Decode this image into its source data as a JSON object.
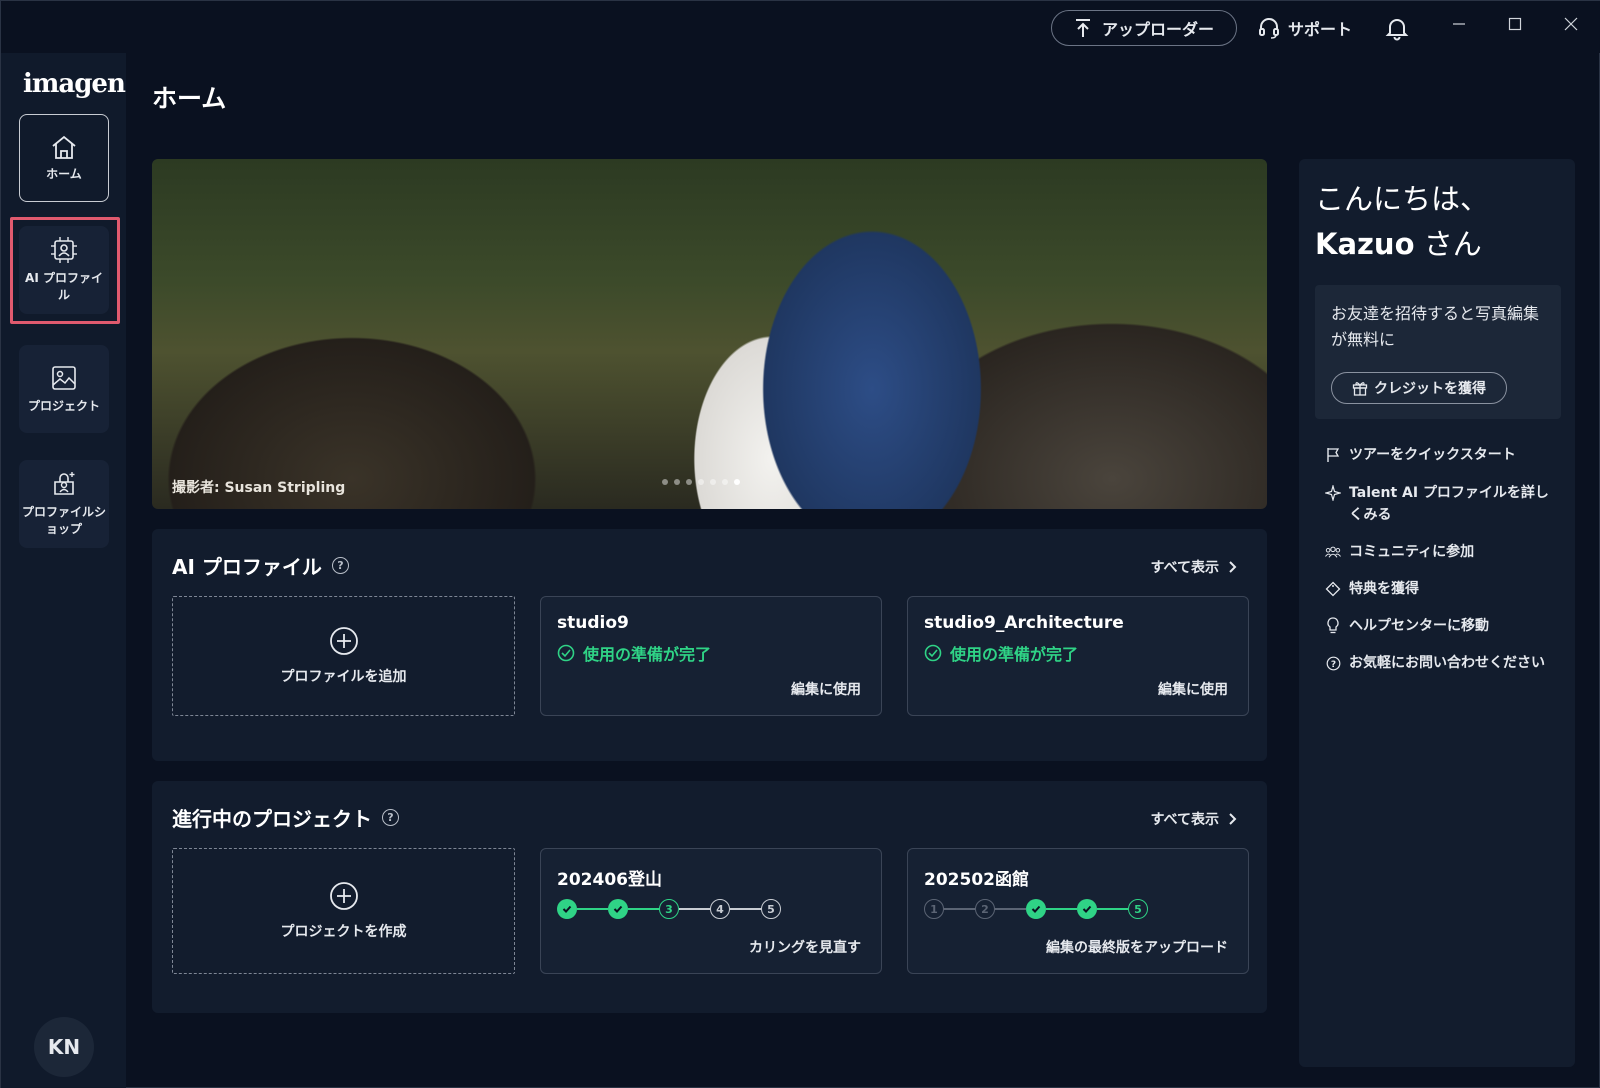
{
  "titlebar": {
    "uploader_label": "アップローダー",
    "support_label": "サポート"
  },
  "sidebar": {
    "logo": "imagen",
    "items": [
      {
        "label": "ホーム",
        "icon": "home-icon",
        "active": true
      },
      {
        "label": "AI プロファイル",
        "icon": "ai-profile-icon",
        "active": false
      },
      {
        "label": "プロジェクト",
        "icon": "project-icon",
        "active": false
      },
      {
        "label": "プロファイルショップ",
        "icon": "profile-shop-icon",
        "active": false
      }
    ],
    "avatar_initials": "KN"
  },
  "main": {
    "page_title": "ホーム",
    "hero": {
      "credit": "撮影者: Susan Stripling",
      "dots": 7,
      "active_dot": 6
    },
    "ai_profiles": {
      "title": "AI プロファイル",
      "see_all": "すべて表示",
      "add_label": "プロファイルを追加",
      "cards": [
        {
          "name": "studio9",
          "status": "使用の準備が完了",
          "action": "編集に使用"
        },
        {
          "name": "studio9_Architecture",
          "status": "使用の準備が完了",
          "action": "編集に使用"
        }
      ]
    },
    "projects": {
      "title": "進行中のプロジェクト",
      "see_all": "すべて表示",
      "create_label": "プロジェクトを作成",
      "cards": [
        {
          "name": "202406登山",
          "action": "カリングを見直す",
          "steps": [
            "done",
            "done",
            "cur",
            "todo",
            "todo"
          ],
          "labels": [
            "1",
            "2",
            "3",
            "4",
            "5"
          ]
        },
        {
          "name": "202502函館",
          "action": "編集の最終版をアップロード",
          "steps": [
            "dim",
            "dim",
            "done",
            "done",
            "cur"
          ],
          "labels": [
            "1",
            "2",
            "3",
            "4",
            "5"
          ]
        }
      ]
    }
  },
  "right_panel": {
    "greeting_line1": "こんにちは、",
    "user_name": "Kazuo",
    "greeting_suffix": " さん",
    "invite_text": "お友達を招待すると写真編集が無料に",
    "credit_button": "クレジットを獲得",
    "links": [
      {
        "label": "ツアーをクイックスタート",
        "icon": "flag-icon"
      },
      {
        "label": "Talent AI プロファイルを詳しくみる",
        "icon": "sparkle-icon"
      },
      {
        "label": "コミュニティに参加",
        "icon": "community-icon"
      },
      {
        "label": "特典を獲得",
        "icon": "tag-icon"
      },
      {
        "label": "ヘルプセンターに移動",
        "icon": "lightbulb-icon"
      },
      {
        "label": "お気軽にお問い合わせください",
        "icon": "question-icon"
      }
    ]
  },
  "colors": {
    "accent_green": "#2fd386",
    "highlight_red": "#e05a6e",
    "background": "#0a1120"
  }
}
